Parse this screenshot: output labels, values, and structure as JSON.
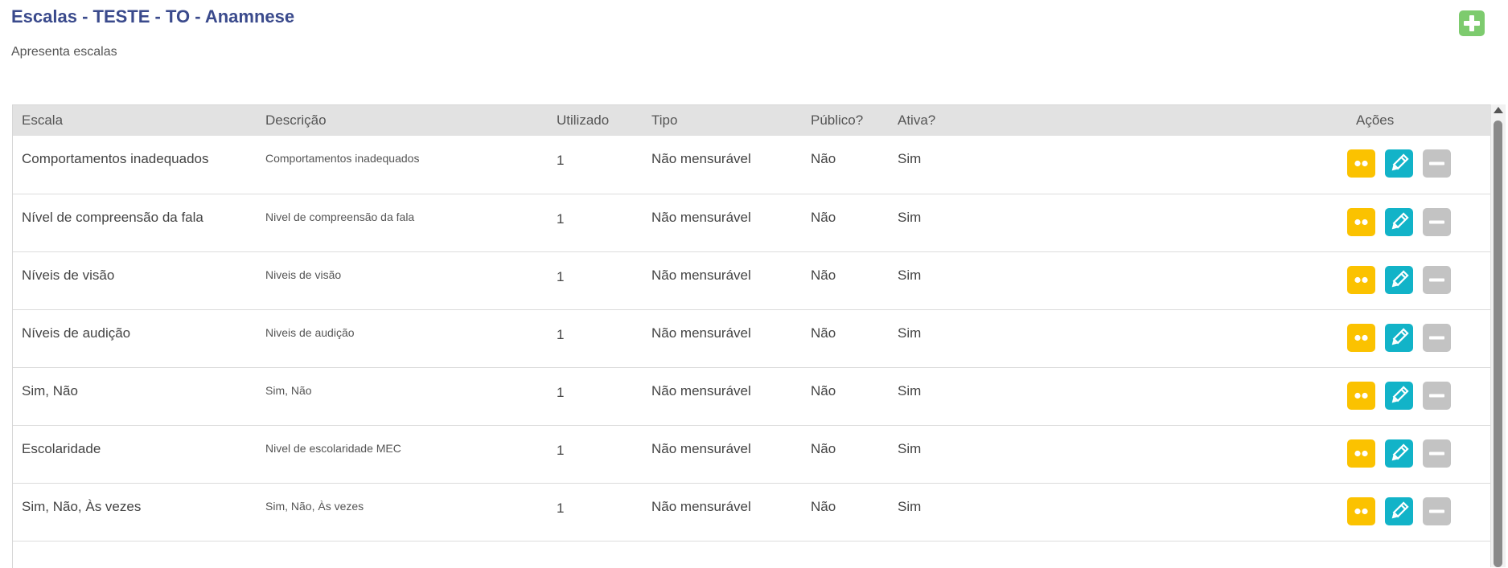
{
  "page": {
    "title": "Escalas - TESTE - TO - Anamnese",
    "subtitle": "Apresenta escalas"
  },
  "icons": {
    "add": "plus-icon",
    "view": "dots-icon",
    "edit": "pencil-icon",
    "remove": "minus-icon"
  },
  "colors": {
    "title": "#3a4a8c",
    "add_button": "#7dcb6e",
    "view_button": "#fbc200",
    "edit_button": "#12b3c8",
    "remove_button": "#c3c3c3",
    "header_bg": "#e2e2e2"
  },
  "table": {
    "headers": {
      "escala": "Escala",
      "descricao": "Descrição",
      "utilizado": "Utilizado",
      "tipo": "Tipo",
      "publico": "Público?",
      "ativa": "Ativa?",
      "acoes": "Ações"
    },
    "rows": [
      {
        "escala": "Comportamentos inadequados",
        "descricao": "Comportamentos inadequados",
        "utilizado": "1",
        "tipo": "Não mensurável",
        "publico": "Não",
        "ativa": "Sim"
      },
      {
        "escala": "Nível de compreensão da fala",
        "descricao": "Nivel de compreensão da fala",
        "utilizado": "1",
        "tipo": "Não mensurável",
        "publico": "Não",
        "ativa": "Sim"
      },
      {
        "escala": "Níveis de visão",
        "descricao": "Niveis de visão",
        "utilizado": "1",
        "tipo": "Não mensurável",
        "publico": "Não",
        "ativa": "Sim"
      },
      {
        "escala": "Níveis de audição",
        "descricao": "Niveis de audição",
        "utilizado": "1",
        "tipo": "Não mensurável",
        "publico": "Não",
        "ativa": "Sim"
      },
      {
        "escala": "Sim, Não",
        "descricao": "Sim, Não",
        "utilizado": "1",
        "tipo": "Não mensurável",
        "publico": "Não",
        "ativa": "Sim"
      },
      {
        "escala": "Escolaridade",
        "descricao": "Nivel de escolaridade MEC",
        "utilizado": "1",
        "tipo": "Não mensurável",
        "publico": "Não",
        "ativa": "Sim"
      },
      {
        "escala": "Sim, Não, Às vezes",
        "descricao": "Sim, Não, Às vezes",
        "utilizado": "1",
        "tipo": "Não mensurável",
        "publico": "Não",
        "ativa": "Sim"
      }
    ]
  }
}
